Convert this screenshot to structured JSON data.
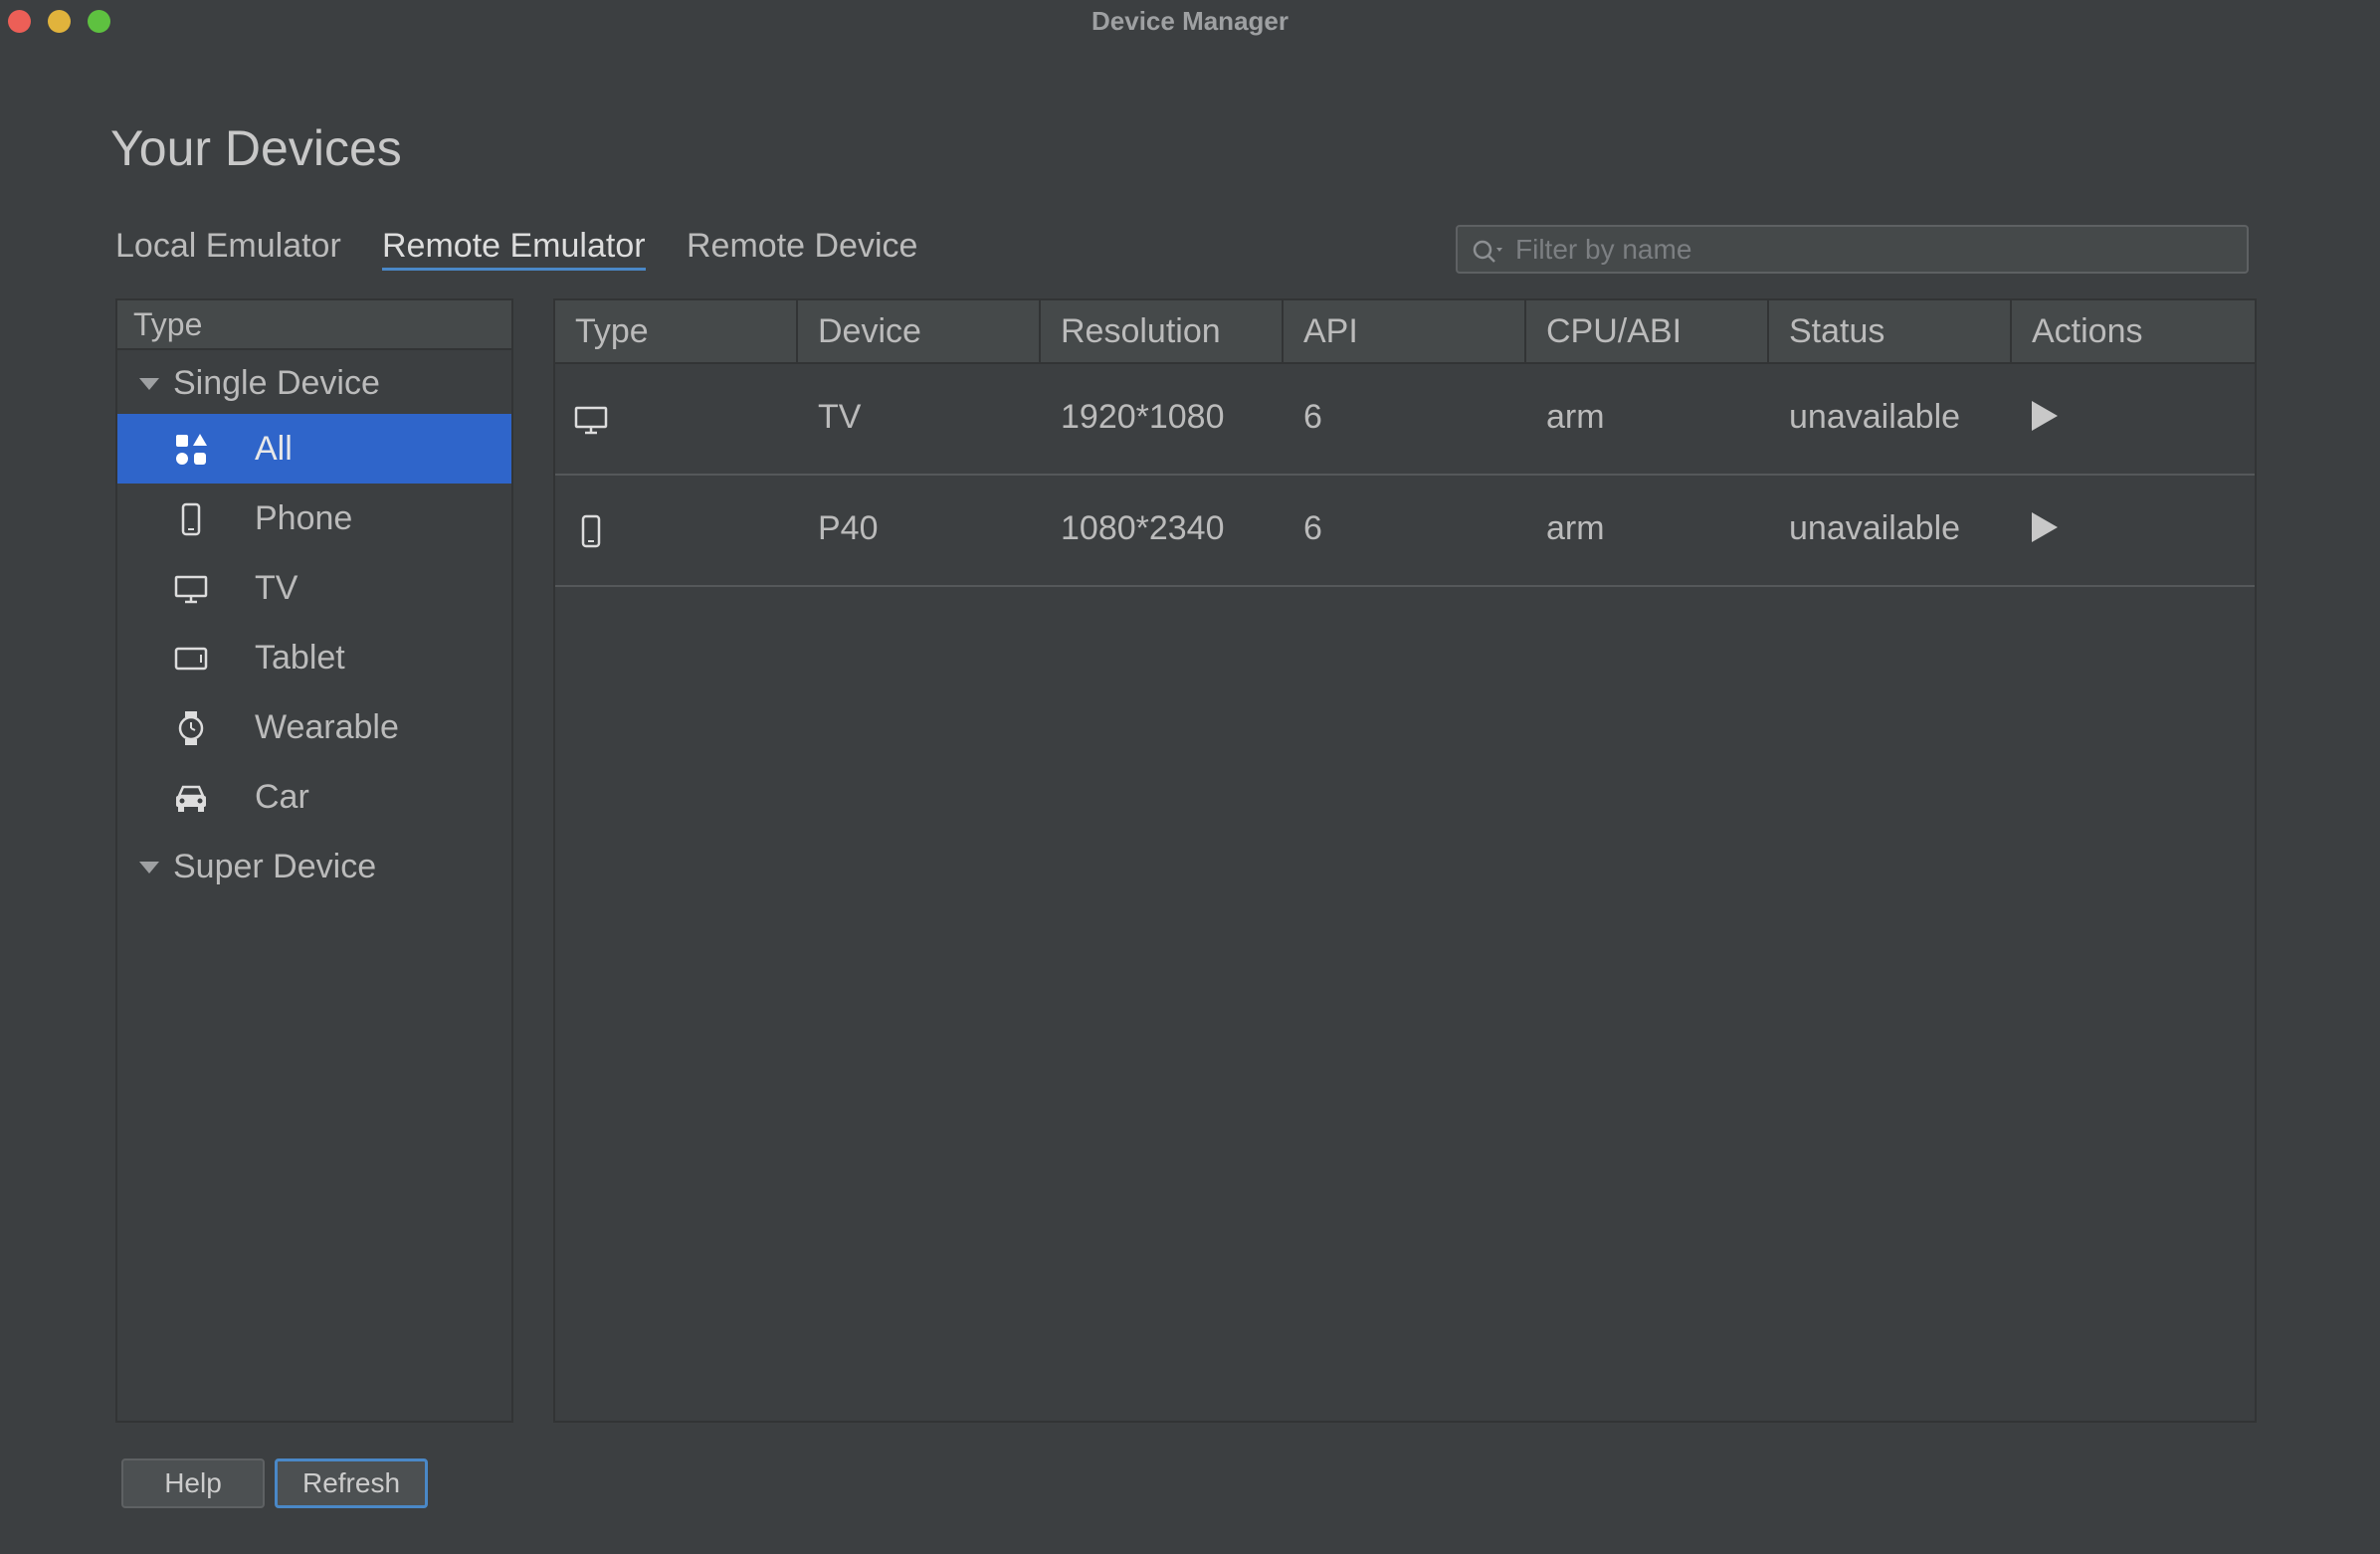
{
  "window": {
    "title": "Device Manager"
  },
  "page": {
    "title": "Your Devices"
  },
  "tabs": [
    {
      "label": "Local Emulator",
      "active": false
    },
    {
      "label": "Remote Emulator",
      "active": true
    },
    {
      "label": "Remote Device",
      "active": false
    }
  ],
  "filter": {
    "placeholder": "Filter by name",
    "value": ""
  },
  "sidebar": {
    "header": "Type",
    "groups": [
      {
        "label": "Single Device",
        "expanded": true,
        "items": [
          {
            "label": "All",
            "icon": "all-icon",
            "selected": true
          },
          {
            "label": "Phone",
            "icon": "phone-icon",
            "selected": false
          },
          {
            "label": "TV",
            "icon": "tv-icon",
            "selected": false
          },
          {
            "label": "Tablet",
            "icon": "tablet-icon",
            "selected": false
          },
          {
            "label": "Wearable",
            "icon": "watch-icon",
            "selected": false
          },
          {
            "label": "Car",
            "icon": "car-icon",
            "selected": false
          }
        ]
      },
      {
        "label": "Super Device",
        "expanded": true,
        "items": []
      }
    ]
  },
  "table": {
    "columns": [
      "Type",
      "Device",
      "Resolution",
      "API",
      "CPU/ABI",
      "Status",
      "Actions"
    ],
    "rows": [
      {
        "type_icon": "tv-icon",
        "device": "TV",
        "resolution": "1920*1080",
        "api": "6",
        "cpu": "arm",
        "status": "unavailable",
        "action_icon": "play-icon"
      },
      {
        "type_icon": "phone-icon",
        "device": "P40",
        "resolution": "1080*2340",
        "api": "6",
        "cpu": "arm",
        "status": "unavailable",
        "action_icon": "play-icon"
      }
    ]
  },
  "footer": {
    "help_label": "Help",
    "refresh_label": "Refresh"
  },
  "colors": {
    "background": "#3c3f41",
    "selection": "#2f65ca",
    "accent": "#4a88c7",
    "text": "#bbbbbb"
  }
}
